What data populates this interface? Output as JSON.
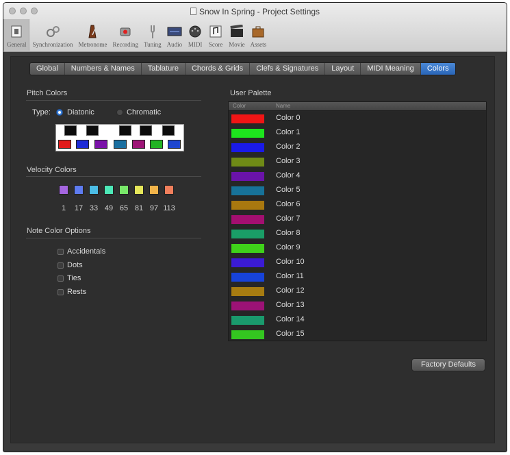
{
  "window": {
    "title": "Snow In Spring - Project Settings"
  },
  "toolbar": [
    {
      "label": "General",
      "icon": "general-icon"
    },
    {
      "label": "Synchronization",
      "icon": "synchronization-icon"
    },
    {
      "label": "Metronome",
      "icon": "metronome-icon"
    },
    {
      "label": "Recording",
      "icon": "record-icon"
    },
    {
      "label": "Tuning",
      "icon": "tuning-fork-icon"
    },
    {
      "label": "Audio",
      "icon": "audio-icon"
    },
    {
      "label": "MIDI",
      "icon": "midi-icon"
    },
    {
      "label": "Score",
      "icon": "score-icon"
    },
    {
      "label": "Movie",
      "icon": "movie-icon"
    },
    {
      "label": "Assets",
      "icon": "assets-icon"
    }
  ],
  "tabs": [
    {
      "label": "Global"
    },
    {
      "label": "Numbers & Names"
    },
    {
      "label": "Tablature"
    },
    {
      "label": "Chords & Grids"
    },
    {
      "label": "Clefs & Signatures"
    },
    {
      "label": "Layout"
    },
    {
      "label": "MIDI Meaning"
    },
    {
      "label": "Colors",
      "active": true
    }
  ],
  "pitch_colors": {
    "title": "Pitch Colors",
    "type_label": "Type:",
    "options": [
      {
        "label": "Diatonic",
        "selected": true
      },
      {
        "label": "Chromatic",
        "selected": false
      }
    ],
    "black_key_count": 5,
    "white_key_swatches": [
      "#e21b1b",
      "#1d2bd6",
      "#7a12a8",
      "#1a6fa0",
      "#9e1577",
      "#22b324",
      "#1e46cf"
    ]
  },
  "velocity_colors": {
    "title": "Velocity Colors",
    "swatches": [
      "#a566e0",
      "#5e7cf0",
      "#4cbde6",
      "#4de8b7",
      "#79e86a",
      "#e5e65a",
      "#f2b44a",
      "#f07f5c"
    ],
    "values": [
      "1",
      "17",
      "33",
      "49",
      "65",
      "81",
      "97",
      "113"
    ]
  },
  "note_color_options": {
    "title": "Note Color Options",
    "options": [
      {
        "label": "Accidentals",
        "checked": false
      },
      {
        "label": "Dots",
        "checked": false
      },
      {
        "label": "Ties",
        "checked": false
      },
      {
        "label": "Rests",
        "checked": false
      }
    ]
  },
  "user_palette": {
    "title": "User Palette",
    "col_color": "Color",
    "col_name": "Name",
    "rows": [
      {
        "name": "Color 0",
        "color": "#f01515"
      },
      {
        "name": "Color 1",
        "color": "#1de51d"
      },
      {
        "name": "Color 2",
        "color": "#1a1ae8"
      },
      {
        "name": "Color 3",
        "color": "#6f8a16"
      },
      {
        "name": "Color 4",
        "color": "#6a13a9"
      },
      {
        "name": "Color 5",
        "color": "#177299"
      },
      {
        "name": "Color 6",
        "color": "#a9780f"
      },
      {
        "name": "Color 7",
        "color": "#a30f70"
      },
      {
        "name": "Color 8",
        "color": "#1a9e67"
      },
      {
        "name": "Color 9",
        "color": "#3fd21a"
      },
      {
        "name": "Color 10",
        "color": "#3b1bd5"
      },
      {
        "name": "Color 11",
        "color": "#1743d9"
      },
      {
        "name": "Color 12",
        "color": "#a77c11"
      },
      {
        "name": "Color 13",
        "color": "#9c1276"
      },
      {
        "name": "Color 14",
        "color": "#1a9a6d"
      },
      {
        "name": "Color 15",
        "color": "#34c620"
      }
    ]
  },
  "factory_defaults_label": "Factory Defaults"
}
